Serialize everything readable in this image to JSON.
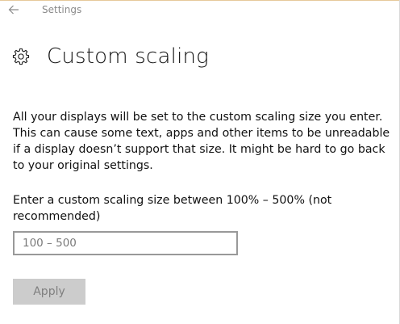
{
  "window": {
    "title": "Settings",
    "back_icon": "back-arrow-icon"
  },
  "header": {
    "icon": "gear-icon",
    "title": "Custom scaling"
  },
  "description": "All your displays will be set to the custom scaling size you enter. This can cause some text, apps and other items to be unreadable if a display doesn’t support that size. It might be hard to go back to your original settings.",
  "scaling": {
    "prompt": "Enter a custom scaling size between 100% – 500% (not recommended)",
    "input_value": "",
    "placeholder": "100 – 500"
  },
  "actions": {
    "apply_label": "Apply",
    "apply_enabled": false
  },
  "colors": {
    "accent_top": "#e6c99a",
    "title_gray": "#8a8a8a",
    "input_border": "#999999",
    "button_disabled_bg": "#cccccc",
    "button_disabled_text": "#7f7f7f"
  }
}
